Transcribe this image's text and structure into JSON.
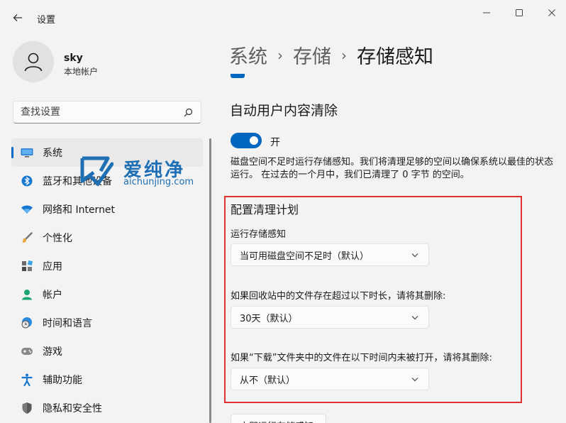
{
  "window": {
    "app_title": "设置"
  },
  "profile": {
    "name": "sky",
    "account_type": "本地帐户"
  },
  "search": {
    "placeholder": "查找设置"
  },
  "sidebar": {
    "items": [
      {
        "label": "系统",
        "icon": "system-display-icon",
        "selected": true
      },
      {
        "label": "蓝牙和其他设备",
        "icon": "bluetooth-icon"
      },
      {
        "label": "网络和 Internet",
        "icon": "wifi-icon"
      },
      {
        "label": "个性化",
        "icon": "brush-icon"
      },
      {
        "label": "应用",
        "icon": "apps-icon"
      },
      {
        "label": "帐户",
        "icon": "person-icon"
      },
      {
        "label": "时间和语言",
        "icon": "globe-clock-icon"
      },
      {
        "label": "游戏",
        "icon": "gamepad-icon"
      },
      {
        "label": "辅助功能",
        "icon": "accessibility-icon"
      },
      {
        "label": "隐私和安全性",
        "icon": "shield-icon"
      }
    ]
  },
  "watermark": {
    "brand": "爱纯净",
    "url": "aichunjing.com"
  },
  "breadcrumb": {
    "level1": "系统",
    "level2": "存储",
    "current": "存储感知",
    "separator": "›"
  },
  "auto_cleanup": {
    "title": "自动用户内容清除",
    "toggle_state": "开",
    "toggle_on": true,
    "description": "磁盘空间不足时运行存储感知。我们将清理足够的空间以确保系统以最佳的状态运行。 在过去的一个月中，我们已清理了 0 字节 的空间。"
  },
  "schedule": {
    "title": "配置清理计划",
    "run_label": "运行存储感知",
    "run_value": "当可用磁盘空间不足时（默认）",
    "recycle_label": "如果回收站中的文件存在超过以下时长，请将其删除:",
    "recycle_value": "30天（默认）",
    "downloads_label": "如果“下载”文件夹中的文件在以下时间内未被打开，请将其删除:",
    "downloads_value": "从不（默认）"
  },
  "bottom_button": {
    "label": "立即运行存储感知"
  },
  "colors": {
    "accent": "#0067c0",
    "highlight_box": "#e03030",
    "background": "#f3f3f3"
  }
}
